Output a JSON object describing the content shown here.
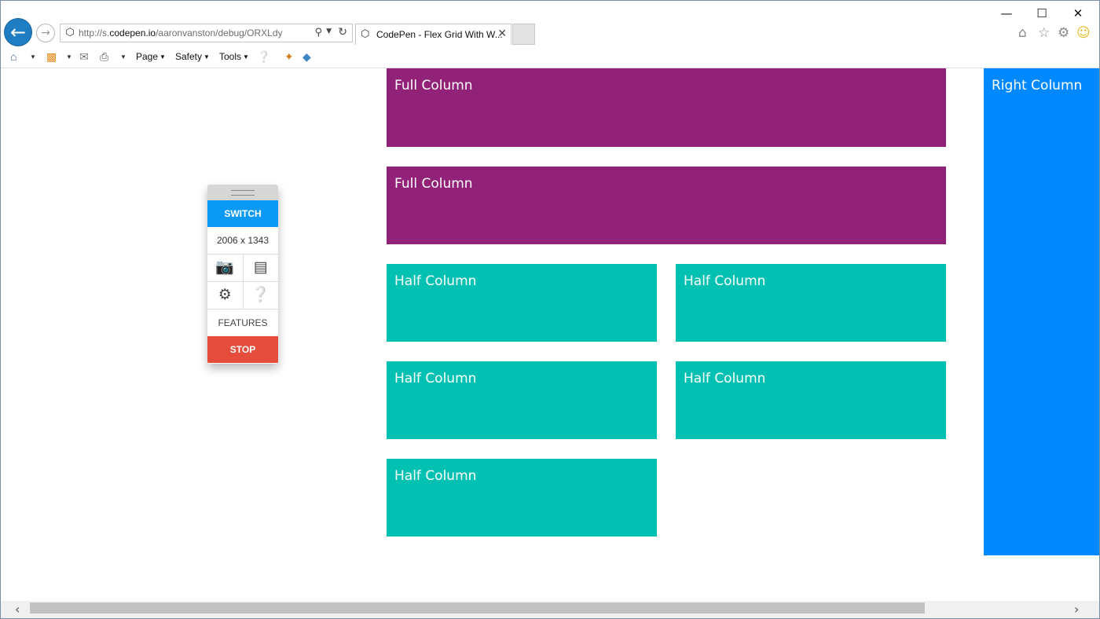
{
  "browser": {
    "address": {
      "url_prefix": "http://s.",
      "url_domain": "codepen.io",
      "url_path": "/aaronvanston/debug/ORXLdy"
    },
    "tab": {
      "label": "CodePen - Flex Grid With W..."
    },
    "command_bar": {
      "page": "Page",
      "safety": "Safety",
      "tools": "Tools"
    }
  },
  "debug_panel": {
    "switch_label": "SWITCH",
    "dimensions": "2006 x 1343",
    "features_label": "FEATURES",
    "stop_label": "STOP"
  },
  "grid": {
    "full_columns": [
      {
        "label": "Full Column"
      },
      {
        "label": "Full Column"
      }
    ],
    "half_columns": [
      {
        "label": "Half Column"
      },
      {
        "label": "Half Column"
      },
      {
        "label": "Half Column"
      },
      {
        "label": "Half Column"
      },
      {
        "label": "Half Column"
      }
    ],
    "right_column": {
      "label": "Right Column"
    }
  },
  "colors": {
    "full_column": "#922278",
    "half_column": "#02c0b2",
    "right_column": "#0088ff",
    "switch": "#0a9af5",
    "stop": "#e54c3c"
  }
}
